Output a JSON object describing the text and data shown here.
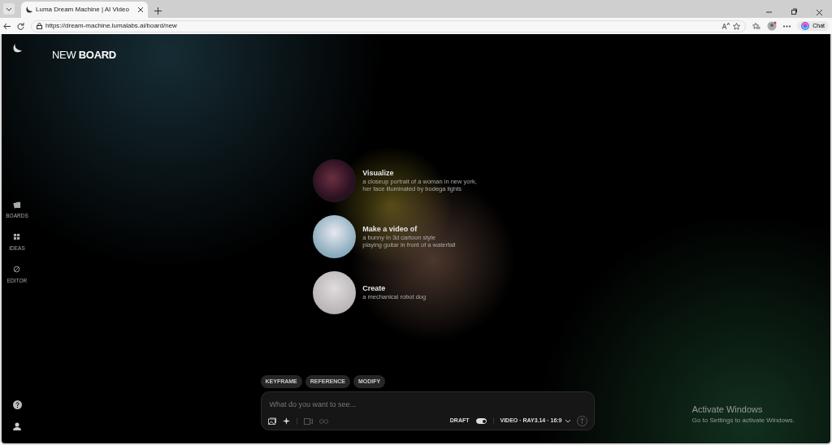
{
  "browser": {
    "tab_title": "Luma Dream Machine | AI Video",
    "url": "https://dream-machine.lumalabs.ai/board/new",
    "chat_label": "Chat"
  },
  "page_title": {
    "light": "NEW",
    "bold": "BOARD"
  },
  "sidebar": {
    "items": [
      {
        "label": "BOARDS"
      },
      {
        "label": "IDEAS"
      },
      {
        "label": "EDITOR"
      }
    ]
  },
  "suggestions": [
    {
      "title": "Visualize",
      "description": "a closeup portrait of a woman in new york,\nher face illuminated by bodega lights"
    },
    {
      "title": "Make a video of",
      "description": "a bunny in 3d cartoon style\nplaying guitar in front of a waterfall"
    },
    {
      "title": "Create",
      "description": "a mechanical robot dog"
    }
  ],
  "modes": [
    "KEYFRAME",
    "REFERENCE",
    "MODIFY"
  ],
  "prompt": {
    "placeholder": "What do you want to see...",
    "draft_label": "DRAFT",
    "draft_on": true,
    "model_label": "VIDEO · RAY3.14 · 16:9"
  },
  "os_notice": {
    "title": "Activate Windows",
    "subtitle": "Go to Settings to activate Windows."
  }
}
